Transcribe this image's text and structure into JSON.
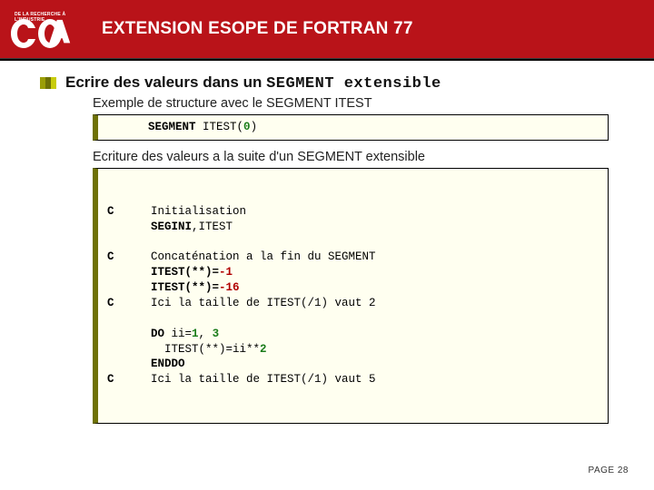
{
  "header": {
    "logo_text_top": "DE LA RECHERCHE À L'INDUSTRIE",
    "title": "EXTENSION ESOPE DE FORTRAN 77"
  },
  "section": {
    "title_prefix": "Ecrire des valeurs dans un ",
    "title_mono1": "SEGMENT",
    "title_mono2": " extensible"
  },
  "sub1": "Exemple de structure avec le SEGMENT ITEST",
  "code1": {
    "kw": "SEGMENT",
    "rest1": " ITEST(",
    "zero": "0",
    "rest2": ")"
  },
  "sub2": "Ecriture des valeurs a la suite d'un SEGMENT extensible",
  "code2": {
    "c": "C",
    "l1": "Initialisation",
    "l2a": "SEGINI",
    "l2b": ",ITEST",
    "l3": "Concaténation a la fin du SEGMENT",
    "l4a": "ITEST(**)=",
    "l4n": "-1",
    "l5a": "ITEST(**)=",
    "l5n": "-16",
    "l6": "Ici la taille de ITEST(/1) vaut 2",
    "l7a": "DO",
    "l7b": " ii=",
    "l7n1": "1",
    "l7c": ", ",
    "l7n2": "3",
    "l8a": "  ITEST(**)=ii**",
    "l8n": "2",
    "l9": "ENDDO",
    "l10": "Ici la taille de ITEST(/1) vaut 5"
  },
  "footer": {
    "page": "PAGE 28"
  },
  "colors": {
    "brand_red": "#b91319",
    "olive_dark": "#6e7105",
    "code_bg": "#fffff0"
  }
}
